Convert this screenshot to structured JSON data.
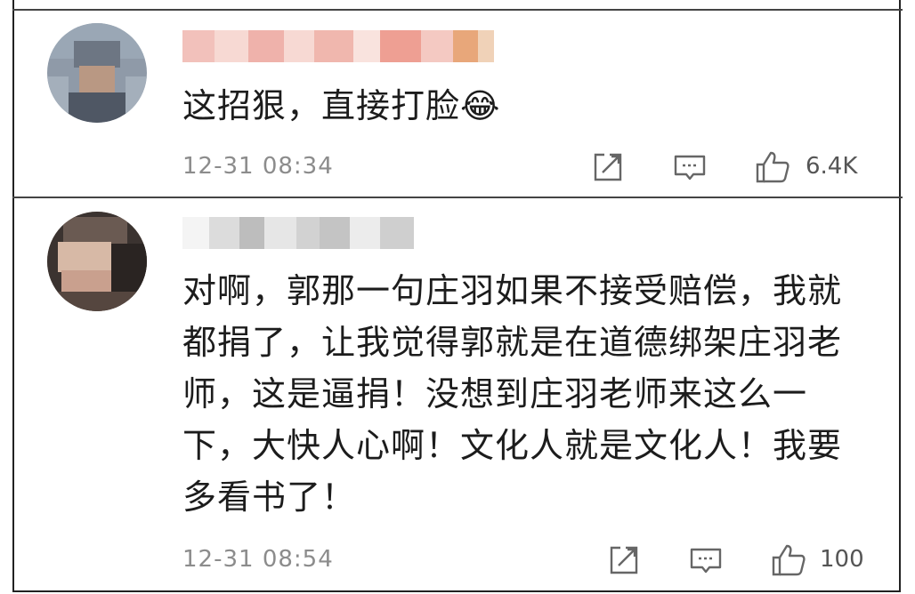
{
  "comments": [
    {
      "text": "这招狠，直接打脸😂",
      "timestamp": "12-31 08:34",
      "likes": "6.4K",
      "icons": [
        "share-icon",
        "comment-icon",
        "like-icon"
      ]
    },
    {
      "lines": [
        "对啊，郭那一句庄羽如果不接受赔偿，我就",
        "都捐了，让我觉得郭就是在道德绑架庄羽老",
        "师，这是逼捐！没想到庄羽老师来这么一",
        "下，大快人心啊！文化人就是文化人！我要",
        "多看书了！"
      ],
      "timestamp": "12-31 08:54",
      "likes": "100",
      "icons": [
        "share-icon",
        "comment-icon",
        "like-icon"
      ]
    }
  ]
}
